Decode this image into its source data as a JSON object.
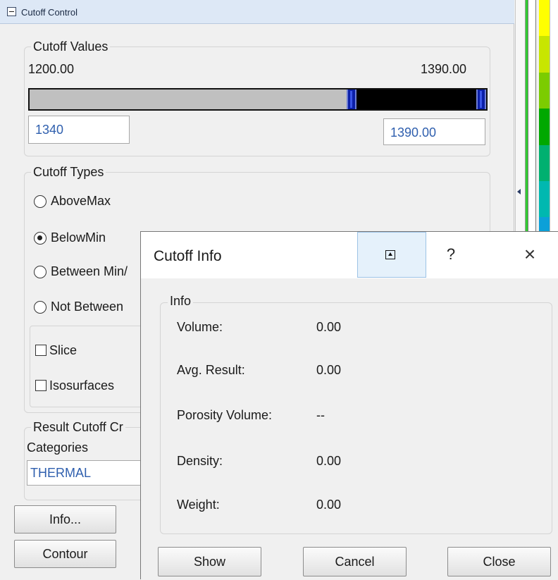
{
  "panel": {
    "title": "Cutoff Control",
    "cutoff_values": {
      "legend": "Cutoff Values",
      "min_label": "1200.00",
      "max_label": "1390.00",
      "low_value": "1340",
      "high_value": "1390.00",
      "range_low_fraction": 0.7105,
      "range_high_fraction": 1.0
    },
    "cutoff_types": {
      "legend": "Cutoff Types",
      "options": [
        {
          "label": "AboveMax",
          "selected": false
        },
        {
          "label": "BelowMin",
          "selected": true
        },
        {
          "label": "Between Min/",
          "selected": false
        },
        {
          "label": "Not Between",
          "selected": false
        }
      ],
      "checks": [
        {
          "label": "Slice",
          "checked": false
        },
        {
          "label": "Isosurfaces",
          "checked": false
        }
      ]
    },
    "result_cutoff": {
      "legend": "Result Cutoff Cr",
      "categories_label": "Categories",
      "category_value": "THERMAL"
    },
    "buttons": {
      "info": "Info...",
      "contour": "Contour"
    }
  },
  "scale_colors": [
    "#ffff00",
    "#c8e600",
    "#7ccc00",
    "#00a800",
    "#00b070",
    "#00b8b0",
    "#0ca0d8",
    "#1060f0",
    "#1020f0",
    "#1400d8",
    "#6000e8",
    "#a000f0",
    "#b000e0",
    "#8800c8",
    "#7000b0",
    "#5a0098"
  ],
  "dialog": {
    "title": "Cutoff Info",
    "help_label": "?",
    "close_label": "×",
    "info_legend": "Info",
    "rows": [
      {
        "label": "Volume:",
        "value": "0.00"
      },
      {
        "label": "Avg. Result:",
        "value": "0.00"
      },
      {
        "label": "Porosity Volume:",
        "value": "--"
      },
      {
        "label": "Density:",
        "value": "0.00"
      },
      {
        "label": "Weight:",
        "value": "0.00"
      }
    ],
    "buttons": {
      "show": "Show",
      "cancel": "Cancel",
      "close": "Close"
    }
  }
}
